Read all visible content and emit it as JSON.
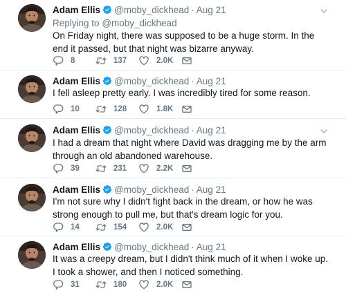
{
  "author": {
    "name": "Adam Ellis",
    "handle": "@moby_dickhead"
  },
  "icons": {
    "verified": "verified-badge-icon",
    "reply": "reply-icon",
    "retweet": "retweet-icon",
    "like": "heart-icon",
    "message": "envelope-icon",
    "caret": "chevron-down-icon"
  },
  "colors": {
    "verified": "#1da1f2",
    "meta_text": "#657786",
    "divider": "#e6ecf0"
  },
  "tweets": [
    {
      "date": "Aug 21",
      "replying_prefix": "Replying to",
      "replying_handle": "@moby_dickhead",
      "text": "On Friday night, there was supposed to be a huge storm. In the end it passed, but that night was bizarre anyway.",
      "replies": "8",
      "retweets": "137",
      "likes": "2.0K"
    },
    {
      "date": "Aug 21",
      "text": "I fell asleep pretty early. I was incredibly tired for some reason.",
      "replies": "10",
      "retweets": "128",
      "likes": "1.8K"
    },
    {
      "date": "Aug 21",
      "text": "I had a dream that night where David was dragging me by the arm through an old abandoned warehouse.",
      "replies": "39",
      "retweets": "231",
      "likes": "2.2K"
    },
    {
      "date": "Aug 21",
      "text": "I'm not sure why I didn't fight back in the dream, or how he was strong enough to pull me, but that's dream logic for you.",
      "replies": "14",
      "retweets": "154",
      "likes": "2.0K"
    },
    {
      "date": "Aug 21",
      "text": "It was a creepy dream, but I didn't think much of it when I woke up. I took a shower, and then I noticed something.",
      "replies": "31",
      "retweets": "180",
      "likes": "2.0K"
    }
  ]
}
